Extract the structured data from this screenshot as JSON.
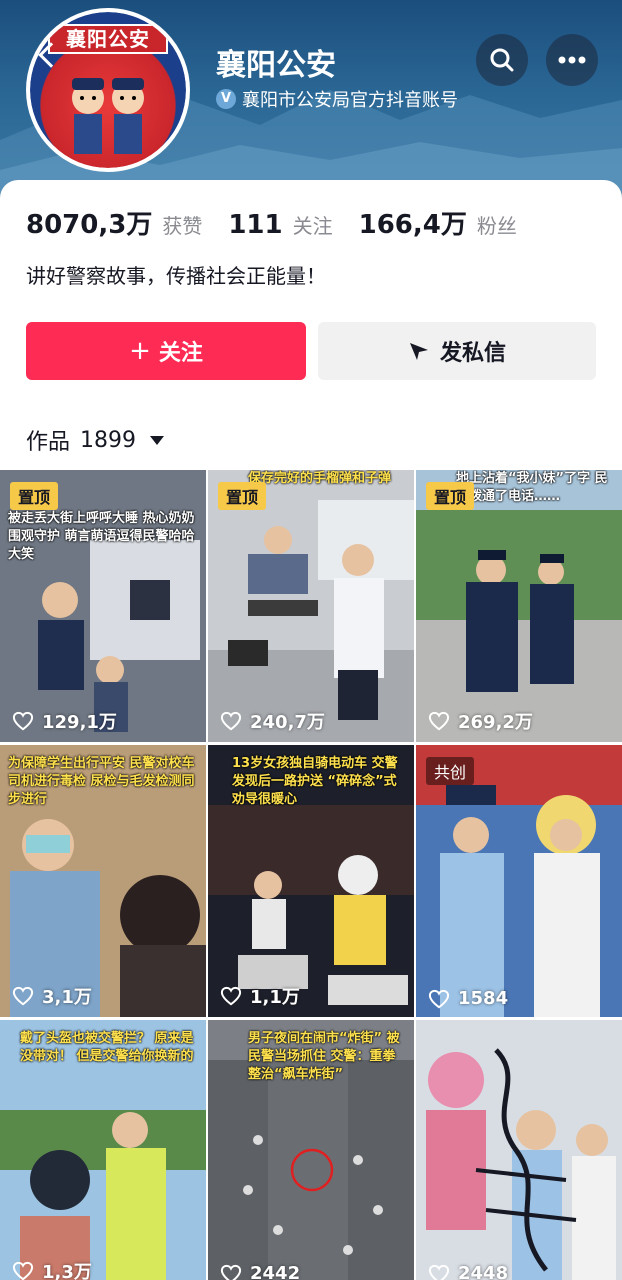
{
  "account": {
    "name": "襄阳公安",
    "verification": "襄阳市公安局官方抖音账号",
    "avatar_text": "襄阳公安"
  },
  "stats": {
    "likes_value": "8070,3万",
    "likes_label": "获赞",
    "following_value": "111",
    "following_label": "关注",
    "followers_value": "166,4万",
    "followers_label": "粉丝"
  },
  "bio": "讲好警察故事，传播社会正能量！",
  "actions": {
    "follow_label": "关注",
    "follow_prefix": "+",
    "message_label": "发私信"
  },
  "works": {
    "label": "作品",
    "count": "1899"
  },
  "icons": {
    "search": "search-icon",
    "more": "more-icon",
    "back": "back-icon",
    "verified": "verified-icon",
    "message": "send-icon",
    "heart": "heart-icon"
  },
  "colors": {
    "accent": "#fe2c55",
    "pinned_tag": "#f7c948",
    "caption_yellow": "#ffe14d"
  },
  "videos": [
    {
      "tag": "置顶",
      "caption": "被走丢大街上呼呼大睡 热心奶奶围观守护 萌言萌语逗得民警哈哈大笑",
      "likes": "129,1万"
    },
    {
      "tag": "置顶",
      "caption": "保存完好的手榴弹和子弹",
      "likes": "240,7万"
    },
    {
      "tag": "置顶",
      "caption": "地上沾着“我小妹”了字 民警拨通了电话……",
      "likes": "269,2万"
    },
    {
      "tag": "",
      "caption": "为保障学生出行平安 民警对校车司机进行毒检 尿检与毛发检测同步进行",
      "likes": "3,1万"
    },
    {
      "tag": "",
      "caption": "13岁女孩独自骑电动车 交警发现后一路护送 “碎碎念”式劝导很暖心",
      "likes": "1,1万"
    },
    {
      "tag": "共创",
      "caption": "",
      "likes": "1584"
    },
    {
      "tag": "",
      "caption": "戴了头盔也被交警拦？ 原来是没带对！ 但是交警给你换新的",
      "likes": "1,3万"
    },
    {
      "tag": "",
      "caption": "男子夜间在闹市“炸街” 被民警当场抓住 交警：重拳整治“飙车炸街”",
      "likes": "2442"
    },
    {
      "tag": "",
      "caption": "",
      "likes": "2448"
    }
  ]
}
